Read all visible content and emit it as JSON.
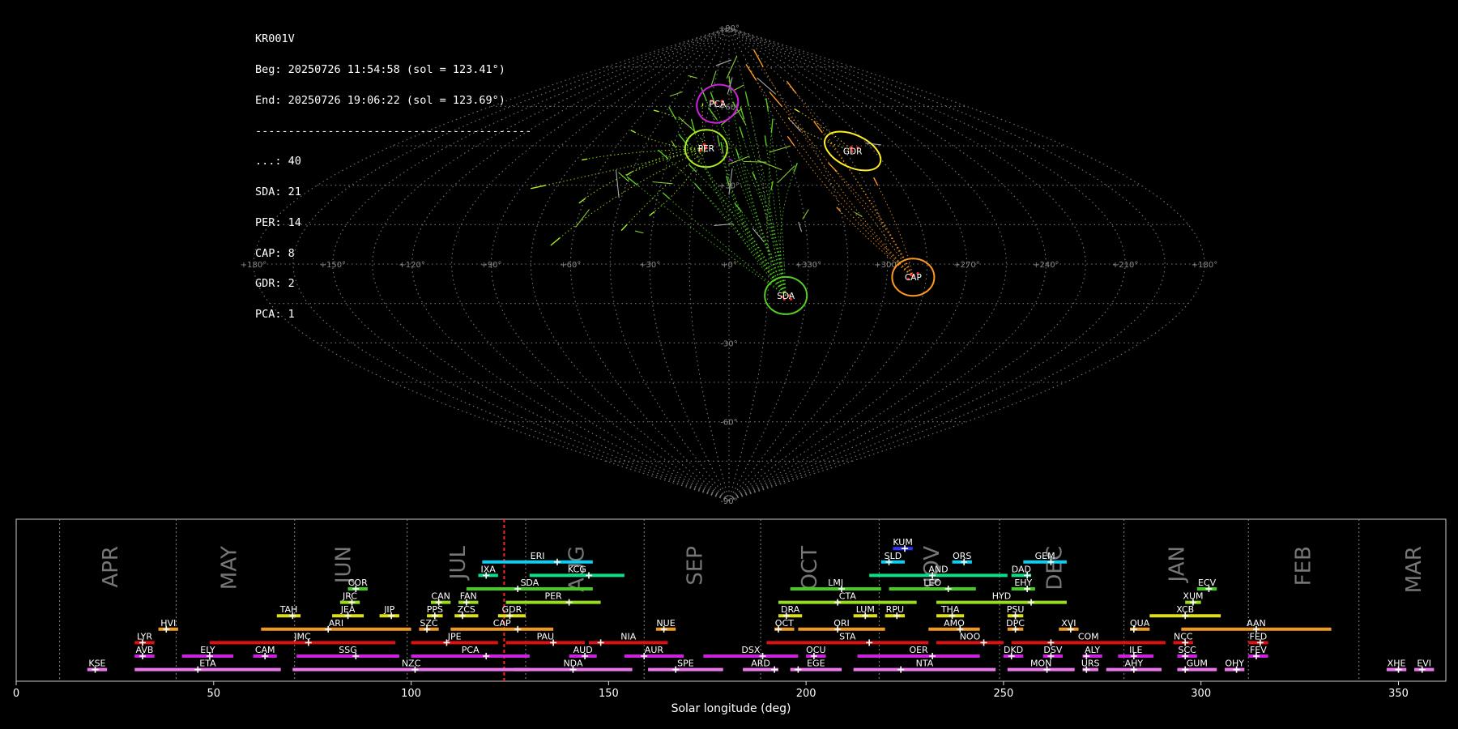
{
  "stats": {
    "station": "KR001V",
    "begin": "Beg: 20250726 11:54:58 (sol = 123.41°)",
    "end": "End: 20250726 19:06:22 (sol = 123.69°)",
    "separator": "------------------------------------------",
    "counts": [
      "...: 40",
      "SDA: 21",
      "PER: 14",
      "CAP: 8",
      "GDR: 2",
      "PCA: 1"
    ]
  },
  "sky_map": {
    "lon_labels": [
      "+180°",
      "+150°",
      "+120°",
      "+90°",
      "+60°",
      "+30°",
      "+0°",
      "+330°",
      "+300°",
      "+270°",
      "+240°",
      "+210°",
      "+180°"
    ],
    "lat_labels": [
      "+90°",
      "+60°",
      "+30°",
      "-30°",
      "-60°",
      "-90°"
    ],
    "radiants": [
      {
        "code": "PCA",
        "lon": -9,
        "lat": 61,
        "color": "#cc22dd"
      },
      {
        "code": "PER",
        "lon": -12,
        "lat": 44,
        "color": "#aaee22"
      },
      {
        "code": "GDR",
        "lon": 64,
        "lat": 43,
        "color": "#ffee22"
      },
      {
        "code": "CAP",
        "lon": 70,
        "lat": -5,
        "color": "#ff9922"
      },
      {
        "code": "SDA",
        "lon": 22,
        "lat": -12,
        "color": "#55cc22"
      }
    ]
  },
  "chart_data": {
    "type": "timeline",
    "xlabel": "Solar longitude (deg)",
    "xlim": [
      0,
      362
    ],
    "xticks": [
      0,
      50,
      100,
      150,
      200,
      250,
      300,
      350
    ],
    "current_sol": 123.55,
    "month_boundaries": [
      11,
      40.5,
      70.5,
      99,
      129,
      159,
      188.5,
      218.5,
      249,
      280.5,
      312,
      340
    ],
    "months": [
      {
        "label": "APR",
        "x": 24
      },
      {
        "label": "MAY",
        "x": 54
      },
      {
        "label": "JUN",
        "x": 83
      },
      {
        "label": "JUL",
        "x": 112
      },
      {
        "label": "AUG",
        "x": 142
      },
      {
        "label": "SEP",
        "x": 172
      },
      {
        "label": "OCT",
        "x": 201
      },
      {
        "label": "NOV",
        "x": 232
      },
      {
        "label": "DEC",
        "x": 263
      },
      {
        "label": "JAN",
        "x": 294
      },
      {
        "label": "FEB",
        "x": 326
      },
      {
        "label": "MAR",
        "x": 354
      }
    ],
    "showers": [
      {
        "code": "KUM",
        "start": 222,
        "end": 227,
        "peak": 225,
        "row": 10,
        "color": "#3333ff"
      },
      {
        "code": "ERI",
        "start": 118,
        "end": 146,
        "peak": 137,
        "row": 9,
        "color": "#11ccee"
      },
      {
        "code": "SLD",
        "start": 219,
        "end": 225,
        "peak": 221,
        "row": 9,
        "color": "#11ccee"
      },
      {
        "code": "ORS",
        "start": 237,
        "end": 242,
        "peak": 240,
        "row": 9,
        "color": "#11ccee"
      },
      {
        "code": "GEM",
        "start": 255,
        "end": 266,
        "peak": 262,
        "row": 9,
        "color": "#11ccee"
      },
      {
        "code": "IXA",
        "start": 117,
        "end": 122,
        "peak": 119,
        "row": 8,
        "color": "#11dd88"
      },
      {
        "code": "KCG",
        "start": 130,
        "end": 154,
        "peak": 145,
        "row": 8,
        "color": "#11dd88"
      },
      {
        "code": "AND",
        "start": 216,
        "end": 251,
        "peak": 232,
        "row": 8,
        "color": "#11dd88"
      },
      {
        "code": "DAD",
        "start": 252,
        "end": 257,
        "peak": 256,
        "row": 8,
        "color": "#11dd88"
      },
      {
        "code": "COR",
        "start": 84,
        "end": 89,
        "peak": 86,
        "row": 7,
        "color": "#44cc22"
      },
      {
        "code": "SDA",
        "start": 114,
        "end": 146,
        "peak": 127,
        "row": 7,
        "color": "#44cc22"
      },
      {
        "code": "LMI",
        "start": 196,
        "end": 219,
        "peak": 209,
        "row": 7,
        "color": "#44cc22"
      },
      {
        "code": "LEO",
        "start": 221,
        "end": 243,
        "peak": 236,
        "row": 7,
        "color": "#44cc22"
      },
      {
        "code": "EHY",
        "start": 252,
        "end": 258,
        "peak": 256,
        "row": 7,
        "color": "#44cc22"
      },
      {
        "code": "ECV",
        "start": 299,
        "end": 304,
        "peak": 302,
        "row": 7,
        "color": "#44cc22"
      },
      {
        "code": "JRC",
        "start": 82,
        "end": 87,
        "peak": 85,
        "row": 6,
        "color": "#99dd22"
      },
      {
        "code": "CAN",
        "start": 105,
        "end": 110,
        "peak": 107,
        "row": 6,
        "color": "#99dd22"
      },
      {
        "code": "FAN",
        "start": 112,
        "end": 117,
        "peak": 114,
        "row": 6,
        "color": "#99dd22"
      },
      {
        "code": "PER",
        "start": 124,
        "end": 148,
        "peak": 140,
        "row": 6,
        "color": "#99dd22"
      },
      {
        "code": "CTA",
        "start": 193,
        "end": 228,
        "peak": 208,
        "row": 6,
        "color": "#99dd22"
      },
      {
        "code": "HYD",
        "start": 233,
        "end": 266,
        "peak": 257,
        "row": 6,
        "color": "#99dd22"
      },
      {
        "code": "XUM",
        "start": 296,
        "end": 300,
        "peak": 298,
        "row": 6,
        "color": "#99dd22"
      },
      {
        "code": "TAH",
        "start": 66,
        "end": 72,
        "peak": 70,
        "row": 5,
        "color": "#dddd22"
      },
      {
        "code": "JEA",
        "start": 80,
        "end": 88,
        "peak": 84,
        "row": 5,
        "color": "#dddd22"
      },
      {
        "code": "JIP",
        "start": 92,
        "end": 97,
        "peak": 95,
        "row": 5,
        "color": "#dddd22"
      },
      {
        "code": "PPS",
        "start": 104,
        "end": 108,
        "peak": 106,
        "row": 5,
        "color": "#dddd22"
      },
      {
        "code": "ZCS",
        "start": 111,
        "end": 117,
        "peak": 113,
        "row": 5,
        "color": "#dddd22"
      },
      {
        "code": "GDR",
        "start": 122,
        "end": 129,
        "peak": 125,
        "row": 5,
        "color": "#dddd22"
      },
      {
        "code": "DRA",
        "start": 193,
        "end": 199,
        "peak": 195,
        "row": 5,
        "color": "#dddd22"
      },
      {
        "code": "LUM",
        "start": 212,
        "end": 218,
        "peak": 215,
        "row": 5,
        "color": "#dddd22"
      },
      {
        "code": "RPU",
        "start": 220,
        "end": 225,
        "peak": 223,
        "row": 5,
        "color": "#dddd22"
      },
      {
        "code": "THA",
        "start": 233,
        "end": 240,
        "peak": 237,
        "row": 5,
        "color": "#dddd22"
      },
      {
        "code": "PSU",
        "start": 251,
        "end": 255,
        "peak": 253,
        "row": 5,
        "color": "#dddd22"
      },
      {
        "code": "XCB",
        "start": 287,
        "end": 305,
        "peak": 296,
        "row": 5,
        "color": "#dddd22"
      },
      {
        "code": "HVI",
        "start": 36,
        "end": 41,
        "peak": 38,
        "row": 4,
        "color": "#ee9922"
      },
      {
        "code": "ARI",
        "start": 62,
        "end": 100,
        "peak": 79,
        "row": 4,
        "color": "#ee9922"
      },
      {
        "code": "SZC",
        "start": 102,
        "end": 107,
        "peak": 104,
        "row": 4,
        "color": "#ee9922"
      },
      {
        "code": "CAP",
        "start": 110,
        "end": 136,
        "peak": 127,
        "row": 4,
        "color": "#ee9922"
      },
      {
        "code": "NUE",
        "start": 162,
        "end": 167,
        "peak": 164,
        "row": 4,
        "color": "#ee9922"
      },
      {
        "code": "OCT",
        "start": 192,
        "end": 197,
        "peak": 193,
        "row": 4,
        "color": "#ee9922"
      },
      {
        "code": "ORI",
        "start": 198,
        "end": 220,
        "peak": 208,
        "row": 4,
        "color": "#ee9922"
      },
      {
        "code": "AMO",
        "start": 231,
        "end": 244,
        "peak": 239,
        "row": 4,
        "color": "#ee9922"
      },
      {
        "code": "DPC",
        "start": 251,
        "end": 255,
        "peak": 253,
        "row": 4,
        "color": "#ee9922"
      },
      {
        "code": "XVI",
        "start": 264,
        "end": 269,
        "peak": 267,
        "row": 4,
        "color": "#ee9922"
      },
      {
        "code": "QUA",
        "start": 282,
        "end": 287,
        "peak": 283,
        "row": 4,
        "color": "#ee9922"
      },
      {
        "code": "AAN",
        "start": 295,
        "end": 333,
        "peak": 314,
        "row": 4,
        "color": "#ee9922"
      },
      {
        "code": "LYR",
        "start": 30,
        "end": 35,
        "peak": 32,
        "row": 3,
        "color": "#dd1111"
      },
      {
        "code": "JMC",
        "start": 49,
        "end": 96,
        "peak": 74,
        "row": 3,
        "color": "#dd1111"
      },
      {
        "code": "JPE",
        "start": 100,
        "end": 122,
        "peak": 109,
        "row": 3,
        "color": "#dd1111"
      },
      {
        "code": "PAU",
        "start": 124,
        "end": 144,
        "peak": 136,
        "row": 3,
        "color": "#dd1111"
      },
      {
        "code": "NIA",
        "start": 145,
        "end": 165,
        "peak": 148,
        "row": 3,
        "color": "#dd1111"
      },
      {
        "code": "STA",
        "start": 190,
        "end": 231,
        "peak": 216,
        "row": 3,
        "color": "#dd1111"
      },
      {
        "code": "NOO",
        "start": 233,
        "end": 250,
        "peak": 245,
        "row": 3,
        "color": "#dd1111"
      },
      {
        "code": "COM",
        "start": 252,
        "end": 291,
        "peak": 262,
        "row": 3,
        "color": "#dd1111"
      },
      {
        "code": "NCC",
        "start": 293,
        "end": 298,
        "peak": 296,
        "row": 3,
        "color": "#dd1111"
      },
      {
        "code": "FED",
        "start": 312,
        "end": 317,
        "peak": 315,
        "row": 3,
        "color": "#dd1111"
      },
      {
        "code": "AVB",
        "start": 30,
        "end": 35,
        "peak": 32,
        "row": 2,
        "color": "#cc22dd"
      },
      {
        "code": "ELY",
        "start": 42,
        "end": 55,
        "peak": 49,
        "row": 2,
        "color": "#cc22dd"
      },
      {
        "code": "CAM",
        "start": 60,
        "end": 66,
        "peak": 63,
        "row": 2,
        "color": "#cc22dd"
      },
      {
        "code": "SSG",
        "start": 71,
        "end": 97,
        "peak": 86,
        "row": 2,
        "color": "#cc22dd"
      },
      {
        "code": "PCA",
        "start": 100,
        "end": 130,
        "peak": 119,
        "row": 2,
        "color": "#cc22dd"
      },
      {
        "code": "AUD",
        "start": 140,
        "end": 147,
        "peak": 144,
        "row": 2,
        "color": "#cc22dd"
      },
      {
        "code": "AUR",
        "start": 154,
        "end": 169,
        "peak": 159,
        "row": 2,
        "color": "#cc22dd"
      },
      {
        "code": "DSX",
        "start": 174,
        "end": 198,
        "peak": 189,
        "row": 2,
        "color": "#cc22dd"
      },
      {
        "code": "OCU",
        "start": 200,
        "end": 205,
        "peak": 202,
        "row": 2,
        "color": "#cc22dd"
      },
      {
        "code": "OER",
        "start": 213,
        "end": 244,
        "peak": 232,
        "row": 2,
        "color": "#cc22dd"
      },
      {
        "code": "DKD",
        "start": 250,
        "end": 255,
        "peak": 252,
        "row": 2,
        "color": "#cc22dd"
      },
      {
        "code": "DSV",
        "start": 260,
        "end": 265,
        "peak": 262,
        "row": 2,
        "color": "#cc22dd"
      },
      {
        "code": "ALY",
        "start": 270,
        "end": 275,
        "peak": 271,
        "row": 2,
        "color": "#cc22dd"
      },
      {
        "code": "ILE",
        "start": 279,
        "end": 288,
        "peak": 283,
        "row": 2,
        "color": "#cc22dd"
      },
      {
        "code": "SCC",
        "start": 294,
        "end": 299,
        "peak": 296,
        "row": 2,
        "color": "#cc22dd"
      },
      {
        "code": "FEV",
        "start": 312,
        "end": 317,
        "peak": 314,
        "row": 2,
        "color": "#cc22dd"
      },
      {
        "code": "KSE",
        "start": 18,
        "end": 23,
        "peak": 20,
        "row": 1,
        "color": "#ee77ee"
      },
      {
        "code": "ETA",
        "start": 30,
        "end": 67,
        "peak": 46,
        "row": 1,
        "color": "#ee77ee"
      },
      {
        "code": "NZC",
        "start": 70,
        "end": 130,
        "peak": 101,
        "row": 1,
        "color": "#ee77ee"
      },
      {
        "code": "NDA",
        "start": 126,
        "end": 156,
        "peak": 141,
        "row": 1,
        "color": "#ee77ee"
      },
      {
        "code": "SPE",
        "start": 160,
        "end": 179,
        "peak": 167,
        "row": 1,
        "color": "#ee77ee"
      },
      {
        "code": "ARD",
        "start": 184,
        "end": 193,
        "peak": 192,
        "row": 1,
        "color": "#ee77ee"
      },
      {
        "code": "EGE",
        "start": 196,
        "end": 209,
        "peak": 198,
        "row": 1,
        "color": "#ee77ee"
      },
      {
        "code": "NTA",
        "start": 212,
        "end": 248,
        "peak": 224,
        "row": 1,
        "color": "#ee77ee"
      },
      {
        "code": "MON",
        "start": 251,
        "end": 268,
        "peak": 261,
        "row": 1,
        "color": "#ee77ee"
      },
      {
        "code": "URS",
        "start": 270,
        "end": 274,
        "peak": 271,
        "row": 1,
        "color": "#ee77ee"
      },
      {
        "code": "AHY",
        "start": 276,
        "end": 290,
        "peak": 283,
        "row": 1,
        "color": "#ee77ee"
      },
      {
        "code": "GUM",
        "start": 294,
        "end": 304,
        "peak": 296,
        "row": 1,
        "color": "#ee77ee"
      },
      {
        "code": "OHY",
        "start": 306,
        "end": 311,
        "peak": 309,
        "row": 1,
        "color": "#ee77ee"
      },
      {
        "code": "XHE",
        "start": 347,
        "end": 352,
        "peak": 350,
        "row": 1,
        "color": "#ee77ee"
      },
      {
        "code": "EVI",
        "start": 354,
        "end": 359,
        "peak": 356,
        "row": 1,
        "color": "#ee77ee"
      }
    ]
  }
}
